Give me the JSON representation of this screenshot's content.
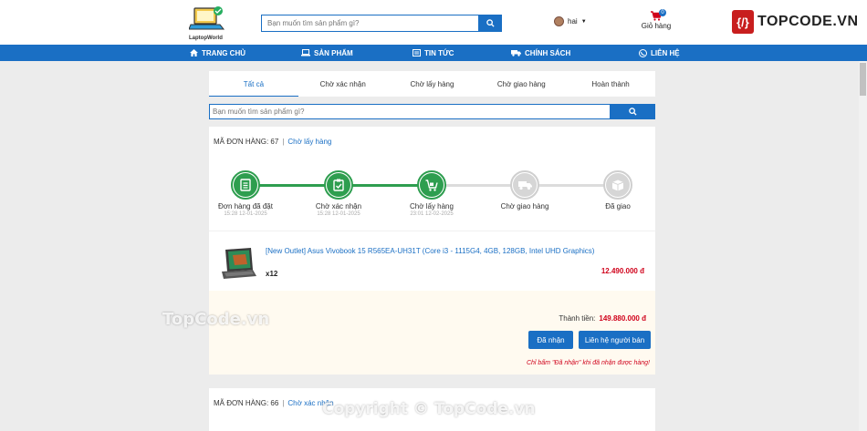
{
  "header": {
    "logo_text": "LaptopWorld",
    "search_placeholder": "Bạn muốn tìm sản phẩm gì?",
    "user_name": "hai",
    "cart_label": "Giỏ hàng",
    "cart_count": "0",
    "brand": "TOPCODE.VN"
  },
  "nav": [
    {
      "label": "TRANG CHỦ",
      "icon": "home-icon"
    },
    {
      "label": "SẢN PHẨM",
      "icon": "laptop-icon"
    },
    {
      "label": "TIN TỨC",
      "icon": "news-icon"
    },
    {
      "label": "CHÍNH SÁCH",
      "icon": "truck-icon"
    },
    {
      "label": "LIÊN HỆ",
      "icon": "contact-icon"
    }
  ],
  "tabs": [
    "Tất cả",
    "Chờ xác nhận",
    "Chờ lấy hàng",
    "Chờ giao hàng",
    "Hoàn thành"
  ],
  "order_search_placeholder": "Bạn muốn tìm sản phẩm gì?",
  "order1": {
    "code_label": "MÃ ĐƠN HÀNG: 67",
    "status": "Chờ lấy hàng",
    "steps": [
      {
        "label": "Đơn hàng đã đặt",
        "time": "15:28 12-01-2025",
        "done": true,
        "icon": "receipt-icon"
      },
      {
        "label": "Chờ xác nhận",
        "time": "15:28 12-01-2025",
        "done": true,
        "icon": "clipboard-check-icon"
      },
      {
        "label": "Chờ lấy hàng",
        "time": "23:01 12-02-2025",
        "done": true,
        "icon": "cart-icon"
      },
      {
        "label": "Chờ giao hàng",
        "time": "",
        "done": false,
        "icon": "truck-icon"
      },
      {
        "label": "Đã giao",
        "time": "",
        "done": false,
        "icon": "box-icon"
      }
    ],
    "product_name": "[New Outlet] Asus Vivobook 15 R565EA-UH31T (Core i3 - 1115G4, 4GB, 128GB, Intel UHD Graphics)",
    "quantity": "x12",
    "price": "12.490.000 đ",
    "total_label": "Thành tiền:",
    "total_value": "149.880.000 đ",
    "received_button": "Đã nhận",
    "contact_button": "Liên hệ người bán",
    "note": "Chỉ bấm \"Đã nhận\" khi đã nhận được hàng!"
  },
  "order2": {
    "code_label": "MÃ ĐƠN HÀNG: 66",
    "status": "Chờ xác nhận"
  },
  "watermarks": [
    "TopCode.vn",
    "Copyright © TopCode.vn"
  ],
  "colors": {
    "primary": "#1a6fc4",
    "success": "#2e9e4f",
    "price": "#d0021b"
  }
}
